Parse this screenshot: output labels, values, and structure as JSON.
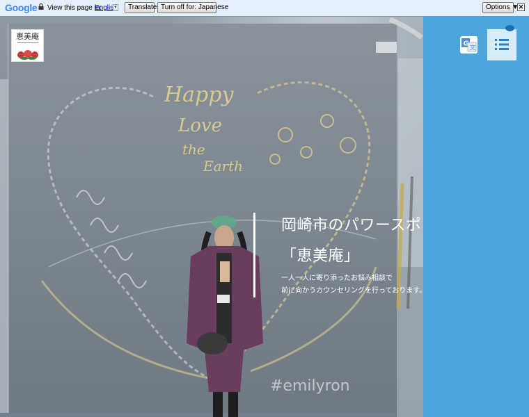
{
  "translate_bar": {
    "logo": "Google",
    "view_text": "View this page in:",
    "language": "English",
    "translate_label": "Translate",
    "turn_off_label": "Turn off for: Japanese",
    "options_label": "Options ▼",
    "close_label": "✕"
  },
  "site": {
    "logo_name": "恵美庵"
  },
  "hero": {
    "title_line1": "岡崎市のパワースポット",
    "title_line2": "「恵美庵」",
    "desc_line1": "一人一人に寄り添ったお悩み相談で",
    "desc_line2": "前に向かうカウンセリングを行っております。",
    "chalk_text1": "Happy",
    "chalk_text2": "Love",
    "chalk_text3": "the",
    "chalk_text4": "Earth",
    "hashtag": "#emilyron"
  },
  "colors": {
    "side_panel": "#4ca6dd",
    "menu_button": "#d6ecf8",
    "menu_icon": "#2a7fc4",
    "notification_dot": "#1a6fb7",
    "chalk_gold": "#e8d48a"
  },
  "icons": {
    "translate": "google-translate-icon",
    "menu": "list-menu-icon",
    "lock": "lock-icon",
    "close": "close-icon"
  }
}
